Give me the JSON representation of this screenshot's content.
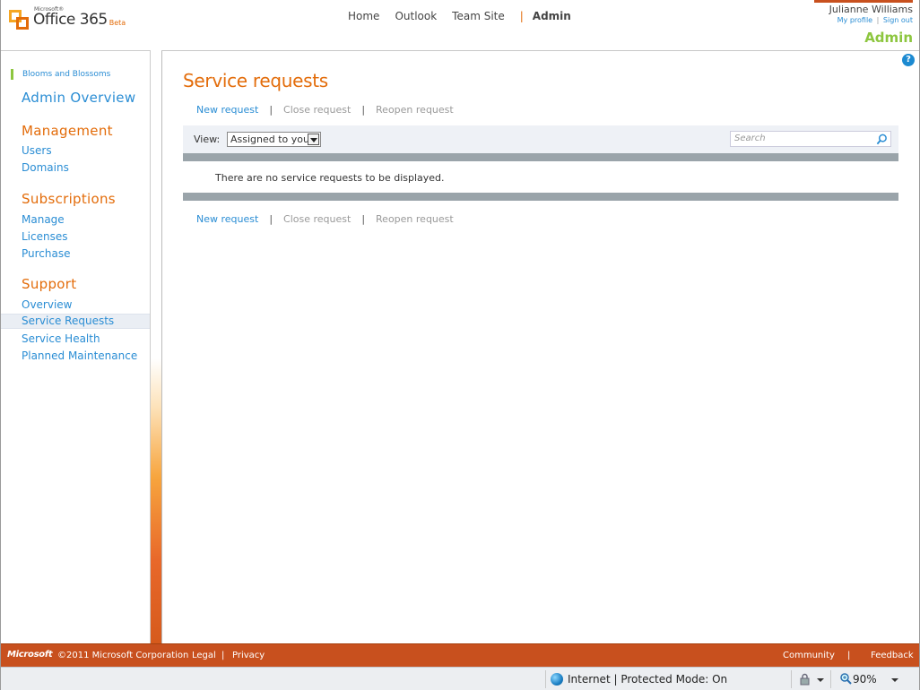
{
  "header": {
    "logo_brand_small": "Microsoft®",
    "logo_product": "Office 365",
    "logo_badge": "Beta",
    "nav": [
      {
        "label": "Home"
      },
      {
        "label": "Outlook"
      },
      {
        "label": "Team Site"
      },
      {
        "label": "Admin"
      }
    ],
    "nav_separator": "|",
    "user_name": "Julianne Williams",
    "my_profile": "My profile",
    "sign_out": "Sign out",
    "user_link_sep": "|",
    "admin_label": "Admin",
    "help_glyph": "?"
  },
  "sidebar": {
    "company": "Blooms and Blossoms",
    "title": "Admin Overview",
    "sections": {
      "management": "Management",
      "subscriptions": "Subscriptions",
      "support": "Support"
    },
    "links": {
      "users": "Users",
      "domains": "Domains",
      "manage": "Manage",
      "licenses": "Licenses",
      "purchase": "Purchase",
      "overview": "Overview",
      "service_requests": "Service Requests",
      "service_health": "Service Health",
      "planned_maintenance": "Planned Maintenance"
    }
  },
  "main": {
    "title": "Service requests",
    "actions": {
      "new_request": "New request",
      "close_request": "Close request",
      "reopen_request": "Reopen request",
      "separator": "|"
    },
    "view_label": "View:",
    "view_selected": "Assigned to you",
    "search_placeholder": "Search",
    "empty_message": "There are no service requests to be displayed."
  },
  "footer": {
    "ms_logo": "Microsoft",
    "copyright": "©2011 Microsoft Corporation",
    "legal": "Legal",
    "privacy": "Privacy",
    "community": "Community",
    "feedback": "Feedback",
    "separator": "|"
  },
  "statusbar": {
    "zone": "Internet | Protected Mode: On",
    "zoom": "90%"
  },
  "colors": {
    "accent_orange": "#e36c0a",
    "link_blue": "#2a8dd4",
    "admin_green": "#8dc63f",
    "footer_bg": "#c8501e"
  },
  "icons": [
    "office-logo-icon",
    "help-icon",
    "dropdown-arrow-icon",
    "search-icon",
    "globe-icon",
    "security-icon",
    "zoom-icon"
  ]
}
